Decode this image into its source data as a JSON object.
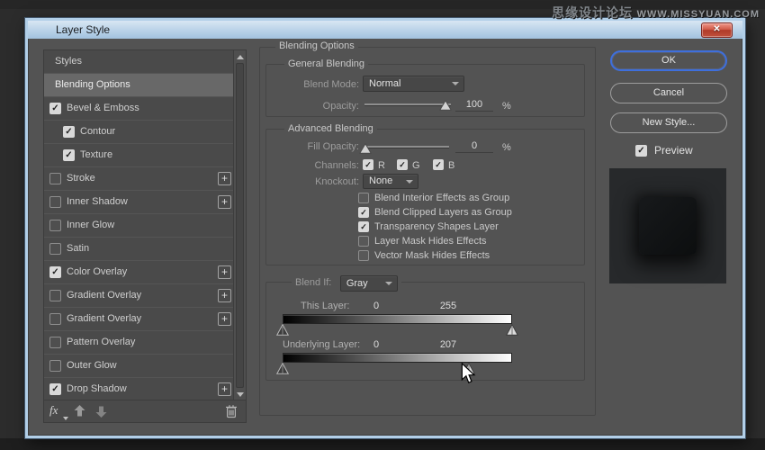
{
  "watermark": {
    "cn": "思缘设计论坛",
    "en": "WWW.MISSYUAN.COM"
  },
  "window": {
    "title": "Layer Style"
  },
  "icons": {
    "close": "✕",
    "check": "✓",
    "plus": "+"
  },
  "styles_panel": {
    "items": [
      {
        "label": "Styles",
        "checkbox": false,
        "checked": false,
        "selected": false,
        "indent": false,
        "plus": false
      },
      {
        "label": "Blending Options",
        "checkbox": false,
        "checked": false,
        "selected": true,
        "indent": false,
        "plus": false
      },
      {
        "label": "Bevel & Emboss",
        "checkbox": true,
        "checked": true,
        "selected": false,
        "indent": false,
        "plus": false
      },
      {
        "label": "Contour",
        "checkbox": true,
        "checked": true,
        "selected": false,
        "indent": true,
        "plus": false
      },
      {
        "label": "Texture",
        "checkbox": true,
        "checked": true,
        "selected": false,
        "indent": true,
        "plus": false
      },
      {
        "label": "Stroke",
        "checkbox": true,
        "checked": false,
        "selected": false,
        "indent": false,
        "plus": true
      },
      {
        "label": "Inner Shadow",
        "checkbox": true,
        "checked": false,
        "selected": false,
        "indent": false,
        "plus": true
      },
      {
        "label": "Inner Glow",
        "checkbox": true,
        "checked": false,
        "selected": false,
        "indent": false,
        "plus": false
      },
      {
        "label": "Satin",
        "checkbox": true,
        "checked": false,
        "selected": false,
        "indent": false,
        "plus": false
      },
      {
        "label": "Color Overlay",
        "checkbox": true,
        "checked": true,
        "selected": false,
        "indent": false,
        "plus": true
      },
      {
        "label": "Gradient Overlay",
        "checkbox": true,
        "checked": false,
        "selected": false,
        "indent": false,
        "plus": true
      },
      {
        "label": "Gradient Overlay",
        "checkbox": true,
        "checked": false,
        "selected": false,
        "indent": false,
        "plus": true
      },
      {
        "label": "Pattern Overlay",
        "checkbox": true,
        "checked": false,
        "selected": false,
        "indent": false,
        "plus": false
      },
      {
        "label": "Outer Glow",
        "checkbox": true,
        "checked": false,
        "selected": false,
        "indent": false,
        "plus": false
      },
      {
        "label": "Drop Shadow",
        "checkbox": true,
        "checked": true,
        "selected": false,
        "indent": false,
        "plus": true
      }
    ],
    "footer": {
      "fx_label": "fx"
    }
  },
  "blending": {
    "panel_title": "Blending Options",
    "general": {
      "title": "General Blending",
      "blend_mode_label": "Blend Mode:",
      "blend_mode_value": "Normal",
      "opacity_label": "Opacity:",
      "opacity_value": "100",
      "percent": "%"
    },
    "advanced": {
      "title": "Advanced Blending",
      "fill_label": "Fill Opacity:",
      "fill_value": "0",
      "percent": "%",
      "channels_label": "Channels:",
      "channels": [
        "R",
        "G",
        "B"
      ],
      "knockout_label": "Knockout:",
      "knockout_value": "None",
      "options": [
        {
          "label": "Blend Interior Effects as Group",
          "checked": false
        },
        {
          "label": "Blend Clipped Layers as Group",
          "checked": true
        },
        {
          "label": "Transparency Shapes Layer",
          "checked": true
        },
        {
          "label": "Layer Mask Hides Effects",
          "checked": false
        },
        {
          "label": "Vector Mask Hides Effects",
          "checked": false
        }
      ]
    },
    "blend_if": {
      "label": "Blend If:",
      "value": "Gray",
      "this_layer_label": "This Layer:",
      "this_low": "0",
      "this_high": "255",
      "underlying_label": "Underlying Layer:",
      "under_low": "0",
      "under_high": "207"
    }
  },
  "actions": {
    "ok": "OK",
    "cancel": "Cancel",
    "new_style": "New Style...",
    "preview_label": "Preview",
    "preview_checked": true
  }
}
